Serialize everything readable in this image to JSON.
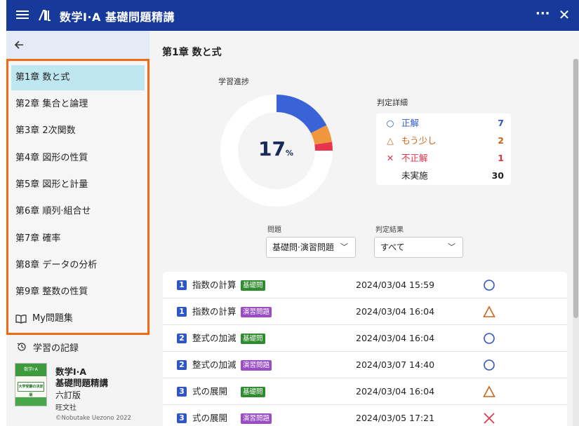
{
  "header": {
    "title": "数学Ⅰ·A 基礎問題精講",
    "more_label": "···",
    "close_label": "✕"
  },
  "sidebar": {
    "chapters": [
      {
        "label": "第1章 数と式"
      },
      {
        "label": "第2章 集合と論理"
      },
      {
        "label": "第3章 2次関数"
      },
      {
        "label": "第4章 図形の性質"
      },
      {
        "label": "第5章 図形と計量"
      },
      {
        "label": "第6章 順列·組合せ"
      },
      {
        "label": "第7章 確率"
      },
      {
        "label": "第8章 データの分析"
      },
      {
        "label": "第9章 整数の性質"
      }
    ],
    "my_book_label": "My問題集",
    "record_label": "学習の記録",
    "book": {
      "title1": "数学Ⅰ·A",
      "title2": "基礎問題精講",
      "edition": "六訂版",
      "publisher": "旺文社",
      "copyright": "©Nobutake Uezono 2022",
      "cover_band": "数学Ⅰ·A",
      "cover_mid": "大学受験の決定版"
    }
  },
  "main": {
    "chapter_title": "第1章 数と式",
    "progress_label": "学習進捗",
    "progress": {
      "percent": "17",
      "unit": "%"
    },
    "donut": {
      "correct": 7,
      "almost": 2,
      "wrong": 1,
      "not_done": 30
    },
    "judge_label": "判定詳細",
    "judge": [
      {
        "symbol": "○",
        "label": "正解",
        "count": "7",
        "color": "#2f56c4"
      },
      {
        "symbol": "△",
        "label": "もう少し",
        "count": "2",
        "color": "#c8651b"
      },
      {
        "symbol": "✕",
        "label": "不正解",
        "count": "1",
        "color": "#e0334a"
      },
      {
        "symbol": "",
        "label": "未実施",
        "count": "30",
        "color": "#222222"
      }
    ],
    "filter_problem_label": "問題",
    "filter_problem_value": "基礎問·演習問題",
    "filter_result_label": "判定結果",
    "filter_result_value": "すべて",
    "rows": [
      {
        "num": "1",
        "name": "指数の計算",
        "badge": "基礎問",
        "date": "2024/03/04 15:59",
        "result": "circle"
      },
      {
        "num": "1",
        "name": "指数の計算",
        "badge": "演習問題",
        "date": "2024/03/04 16:04",
        "result": "triangle"
      },
      {
        "num": "2",
        "name": "整式の加減",
        "badge": "基礎問",
        "date": "2024/03/04 16:04",
        "result": "circle"
      },
      {
        "num": "2",
        "name": "整式の加減",
        "badge": "演習問題",
        "date": "2024/03/07 14:40",
        "result": "circle"
      },
      {
        "num": "3",
        "name": "式の展開",
        "badge": "基礎問",
        "date": "2024/03/04 16:04",
        "result": "triangle"
      },
      {
        "num": "3",
        "name": "式の展開",
        "badge": "演習問題",
        "date": "2024/03/05 17:21",
        "result": "cross"
      }
    ]
  },
  "colors": {
    "header": "#173a9a",
    "highlight_border": "#ef6a12",
    "active_chapter": "#bfe7f2",
    "correct": "#3a63d8",
    "almost": "#f0963c",
    "wrong": "#e8354d",
    "not_done": "#ffffff",
    "badge_basic": "#2e8b2e",
    "badge_practice": "#9a4cc7"
  }
}
